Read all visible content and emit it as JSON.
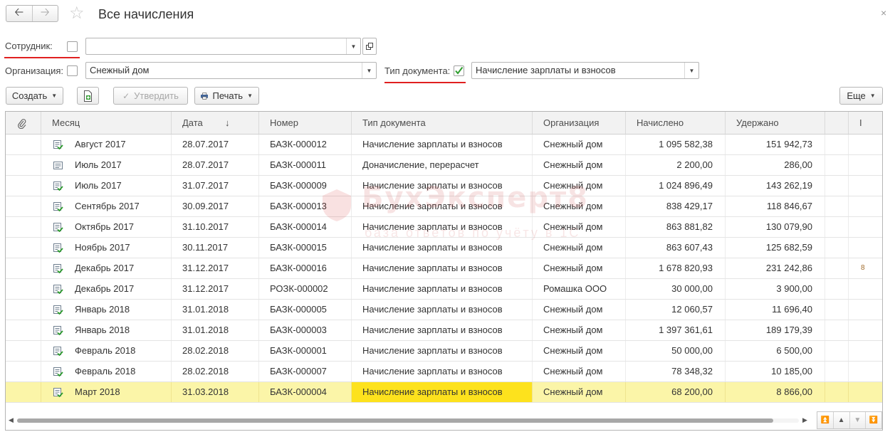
{
  "window": {
    "title": "Все начисления",
    "back_icon": "arrow-left-icon",
    "forward_icon": "arrow-right-icon",
    "favorite_icon": "star-icon",
    "close_label": "×"
  },
  "filters": {
    "employee_label": "Сотрудник:",
    "employee_value": "",
    "organization_label": "Организация:",
    "organization_value": "Снежный дом",
    "doc_type_label": "Тип документа:",
    "doc_type_value": "Начисление зарплаты и взносов",
    "doc_type_checked": true,
    "accent_red": "#e02020",
    "check_green": "#2e9d2e"
  },
  "toolbar": {
    "create_label": "Создать",
    "approve_label": "Утвердить",
    "print_label": "Печать",
    "more_label": "Еще"
  },
  "table": {
    "columns": {
      "attach": "",
      "month": "Месяц",
      "date": "Дата",
      "sort_arrow": "↓",
      "number": "Номер",
      "doc_type": "Тип документа",
      "organization": "Организация",
      "accrued": "Начислено",
      "withheld": "Удержано",
      "extra1": "",
      "extra2": "I"
    },
    "rows": [
      {
        "month": "Август 2017",
        "date": "28.07.2017",
        "number": "БАЗК-000012",
        "doc_type": "Начисление зарплаты и взносов",
        "org": "Снежный дом",
        "accrued": "1 095 582,38",
        "withheld": "151 942,73",
        "posted": true
      },
      {
        "month": "Июль 2017",
        "date": "28.07.2017",
        "number": "БАЗК-000011",
        "doc_type": "Доначисление, перерасчет",
        "org": "Снежный дом",
        "accrued": "2 200,00",
        "withheld": "286,00",
        "posted": false
      },
      {
        "month": "Июль 2017",
        "date": "31.07.2017",
        "number": "БАЗК-000009",
        "doc_type": "Начисление зарплаты и взносов",
        "org": "Снежный дом",
        "accrued": "1 024 896,49",
        "withheld": "143 262,19",
        "posted": true
      },
      {
        "month": "Сентябрь 2017",
        "date": "30.09.2017",
        "number": "БАЗК-000013",
        "doc_type": "Начисление зарплаты и взносов",
        "org": "Снежный дом",
        "accrued": "838 429,17",
        "withheld": "118 846,67",
        "posted": true
      },
      {
        "month": "Октябрь 2017",
        "date": "31.10.2017",
        "number": "БАЗК-000014",
        "doc_type": "Начисление зарплаты и взносов",
        "org": "Снежный дом",
        "accrued": "863 881,82",
        "withheld": "130 079,90",
        "posted": true
      },
      {
        "month": "Ноябрь 2017",
        "date": "30.11.2017",
        "number": "БАЗК-000015",
        "doc_type": "Начисление зарплаты и взносов",
        "org": "Снежный дом",
        "accrued": "863 607,43",
        "withheld": "125 682,59",
        "posted": true
      },
      {
        "month": "Декабрь 2017",
        "date": "31.12.2017",
        "number": "БАЗК-000016",
        "doc_type": "Начисление зарплаты и взносов",
        "org": "Снежный дом",
        "accrued": "1 678 820,93",
        "withheld": "231 242,86",
        "posted": true,
        "extra": "8"
      },
      {
        "month": "Декабрь 2017",
        "date": "31.12.2017",
        "number": "РОЗК-000002",
        "doc_type": "Начисление зарплаты и взносов",
        "org": "Ромашка ООО",
        "accrued": "30 000,00",
        "withheld": "3 900,00",
        "posted": true
      },
      {
        "month": "Январь 2018",
        "date": "31.01.2018",
        "number": "БАЗК-000005",
        "doc_type": "Начисление зарплаты и взносов",
        "org": "Снежный дом",
        "accrued": "12 060,57",
        "withheld": "11 696,40",
        "posted": true
      },
      {
        "month": "Январь 2018",
        "date": "31.01.2018",
        "number": "БАЗК-000003",
        "doc_type": "Начисление зарплаты и взносов",
        "org": "Снежный дом",
        "accrued": "1 397 361,61",
        "withheld": "189 179,39",
        "posted": true
      },
      {
        "month": "Февраль 2018",
        "date": "28.02.2018",
        "number": "БАЗК-000001",
        "doc_type": "Начисление зарплаты и взносов",
        "org": "Снежный дом",
        "accrued": "50 000,00",
        "withheld": "6 500,00",
        "posted": true
      },
      {
        "month": "Февраль 2018",
        "date": "28.02.2018",
        "number": "БАЗК-000007",
        "doc_type": "Начисление зарплаты и взносов",
        "org": "Снежный дом",
        "accrued": "78 348,32",
        "withheld": "10 185,00",
        "posted": true
      },
      {
        "month": "Март 2018",
        "date": "31.03.2018",
        "number": "БАЗК-000004",
        "doc_type": "Начисление зарплаты и взносов",
        "org": "Снежный дом",
        "accrued": "68 200,00",
        "withheld": "8 866,00",
        "posted": true,
        "selected": true
      }
    ],
    "selected_row_color": "#fbf5a8",
    "selected_cell_color": "#fde21d"
  },
  "watermark": {
    "brand": "БухЭксперт8",
    "tagline": "база ответов по учёту в 1С"
  }
}
